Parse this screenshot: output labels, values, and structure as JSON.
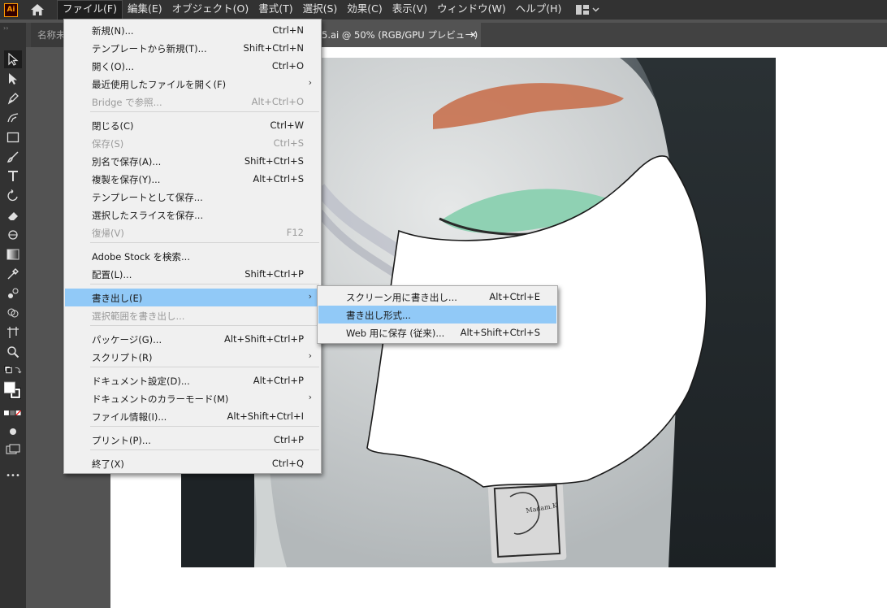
{
  "app": {
    "logo_text": "Ai"
  },
  "menubar": {
    "items": [
      {
        "label": "ファイル(F)",
        "active": true
      },
      {
        "label": "編集(E)"
      },
      {
        "label": "オブジェクト(O)"
      },
      {
        "label": "書式(T)"
      },
      {
        "label": "選択(S)"
      },
      {
        "label": "効果(C)"
      },
      {
        "label": "表示(V)"
      },
      {
        "label": "ウィンドウ(W)"
      },
      {
        "label": "ヘルプ(H)"
      }
    ]
  },
  "tabs": {
    "left_partial": "名称未",
    "active_partial": "5.ai @ 50% (RGB/GPU プレビュー)",
    "close_glyph": "×"
  },
  "toolbar": {
    "grip": "››",
    "more": "•••"
  },
  "file_menu": {
    "items": [
      {
        "label": "新規(N)...",
        "shortcut": "Ctrl+N"
      },
      {
        "label": "テンプレートから新規(T)...",
        "shortcut": "Shift+Ctrl+N"
      },
      {
        "label": "開く(O)...",
        "shortcut": "Ctrl+O"
      },
      {
        "label": "最近使用したファイルを開く(F)",
        "shortcut": "",
        "submenu": true
      },
      {
        "label": "Bridge で参照...",
        "shortcut": "Alt+Ctrl+O",
        "disabled": true
      },
      {
        "label": "閉じる(C)",
        "shortcut": "Ctrl+W"
      },
      {
        "label": "保存(S)",
        "shortcut": "Ctrl+S",
        "disabled": true
      },
      {
        "label": "別名で保存(A)...",
        "shortcut": "Shift+Ctrl+S"
      },
      {
        "label": "複製を保存(Y)...",
        "shortcut": "Alt+Ctrl+S"
      },
      {
        "label": "テンプレートとして保存...",
        "shortcut": ""
      },
      {
        "label": "選択したスライスを保存...",
        "shortcut": ""
      },
      {
        "label": "復帰(V)",
        "shortcut": "F12",
        "disabled": true
      },
      {
        "label": "Adobe Stock を検索...",
        "shortcut": ""
      },
      {
        "label": "配置(L)...",
        "shortcut": "Shift+Ctrl+P"
      },
      {
        "label": "書き出し(E)",
        "shortcut": "",
        "submenu": true,
        "highlighted": true
      },
      {
        "label": "選択範囲を書き出し...",
        "shortcut": "",
        "disabled": true
      },
      {
        "label": "パッケージ(G)...",
        "shortcut": "Alt+Shift+Ctrl+P"
      },
      {
        "label": "スクリプト(R)",
        "shortcut": "",
        "submenu": true
      },
      {
        "label": "ドキュメント設定(D)...",
        "shortcut": "Alt+Ctrl+P"
      },
      {
        "label": "ドキュメントのカラーモード(M)",
        "shortcut": "",
        "submenu": true
      },
      {
        "label": "ファイル情報(I)...",
        "shortcut": "Alt+Shift+Ctrl+I"
      },
      {
        "label": "プリント(P)...",
        "shortcut": "Ctrl+P"
      },
      {
        "label": "終了(X)",
        "shortcut": "Ctrl+Q"
      }
    ]
  },
  "export_submenu": {
    "items": [
      {
        "label": "スクリーン用に書き出し...",
        "shortcut": "Alt+Ctrl+E"
      },
      {
        "label": "書き出し形式...",
        "shortcut": "",
        "highlighted": true
      },
      {
        "label": "Web 用に保存 (従来)...",
        "shortcut": "Alt+Shift+Ctrl+S"
      }
    ]
  },
  "colors": {
    "menu_highlight": "#91c9f7",
    "menubar_bg": "#323232",
    "accent_logo": "#ff9a00"
  },
  "icons": {
    "menu_submenu_arrow": "›",
    "workspace": "workspace-switcher-icon"
  },
  "artwork": {
    "tag_text": "Madam.K"
  }
}
